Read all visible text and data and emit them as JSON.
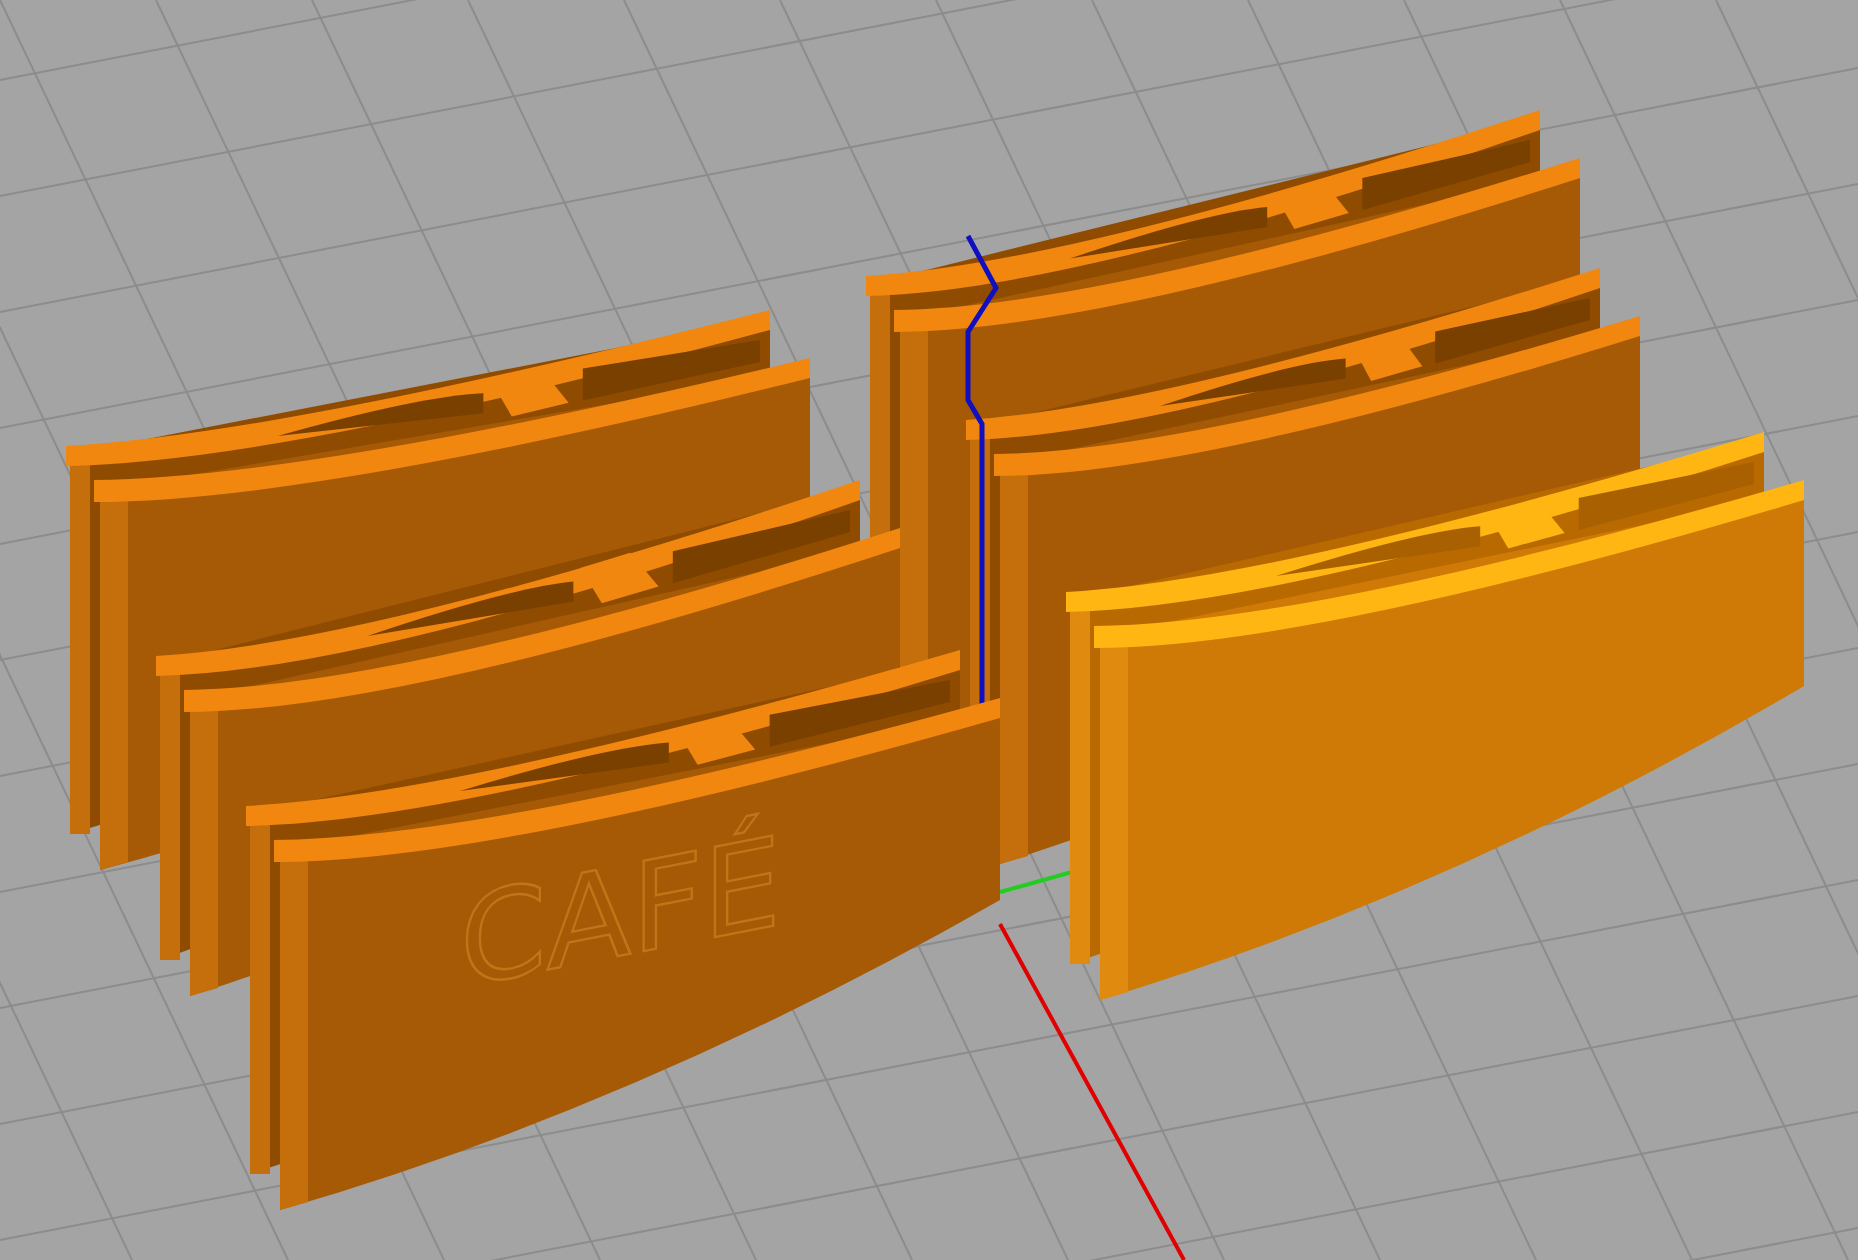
{
  "viewport": {
    "clips": [
      {
        "selected": false
      },
      {
        "selected": false
      },
      {
        "selected": false
      },
      {
        "selected": false
      },
      {
        "selected": false,
        "label": "CAFÉ"
      },
      {
        "selected": true
      }
    ]
  }
}
